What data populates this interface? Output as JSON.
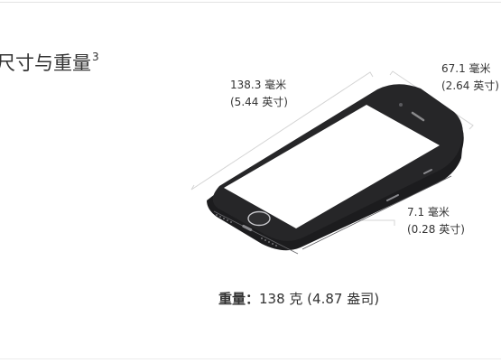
{
  "section": {
    "title": "尺寸与重量",
    "footnote": "3"
  },
  "dimensions": {
    "length": {
      "metric": "138.3 毫米",
      "imperial": "(5.44 英寸)"
    },
    "width": {
      "metric": "67.1 毫米",
      "imperial": "(2.64 英寸)"
    },
    "depth": {
      "metric": "7.1 毫米",
      "imperial": "(0.28 英寸)"
    }
  },
  "weight": {
    "label": "重量：",
    "value": "138 克 (4.87 盎司)"
  },
  "icons": {
    "phone": "iphone-outline-illustration"
  },
  "colors": {
    "text": "#333333",
    "phone_body": "#1c1c1e",
    "dimension_line": "#d4d4d4"
  }
}
